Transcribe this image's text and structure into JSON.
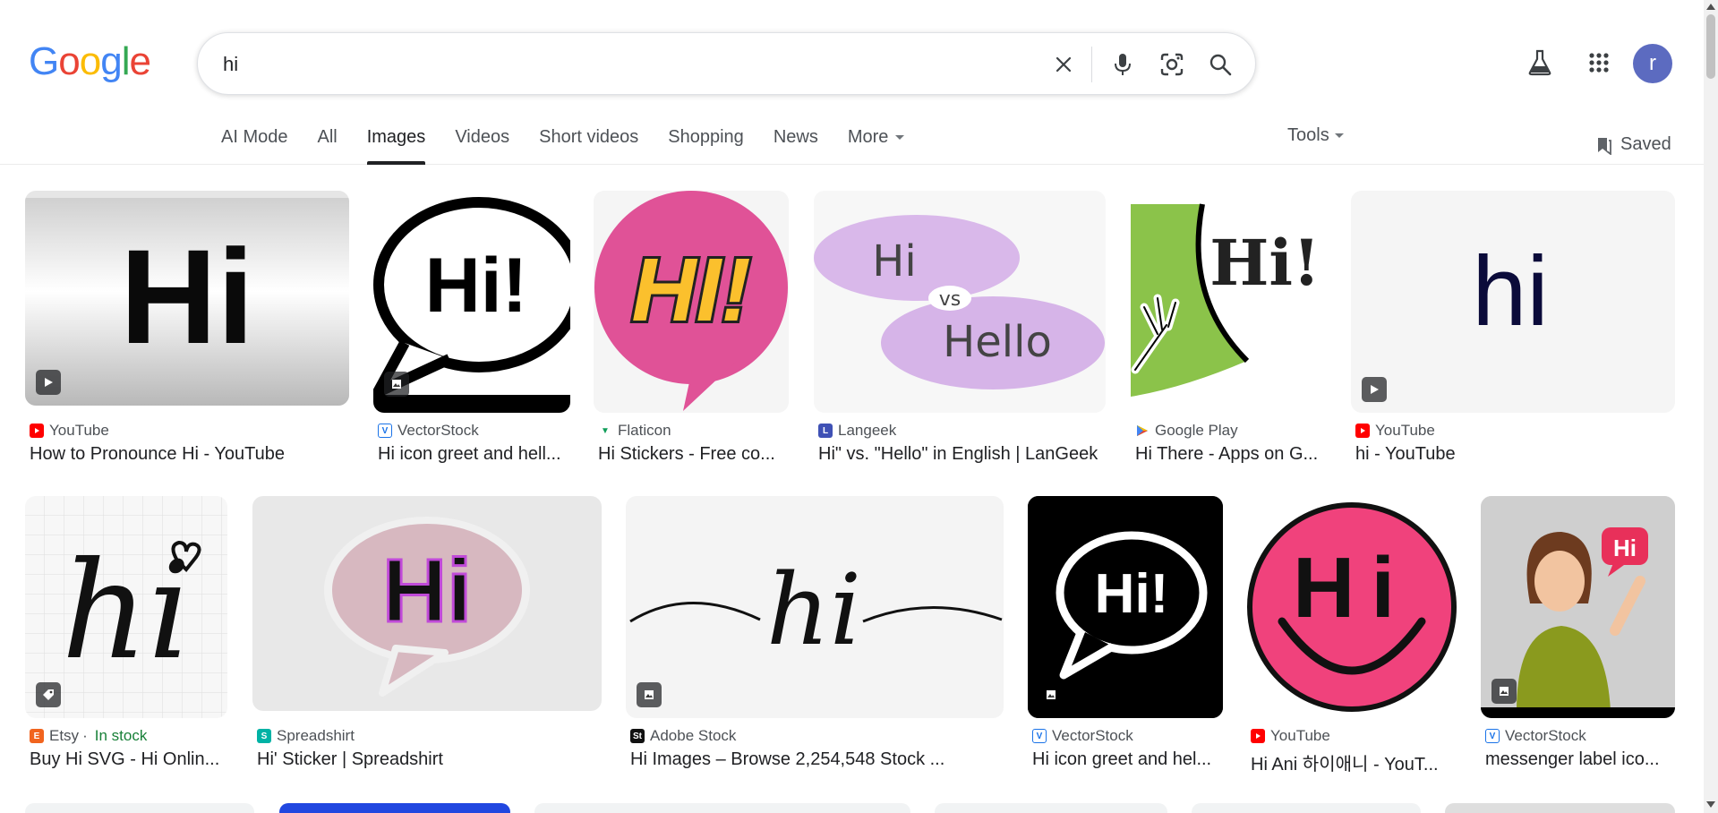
{
  "logo": {
    "letters": [
      "G",
      "o",
      "o",
      "g",
      "l",
      "e"
    ],
    "colors": [
      "#4285F4",
      "#EA4335",
      "#FBBC05",
      "#4285F4",
      "#34A853",
      "#EA4335"
    ]
  },
  "search": {
    "value": "hi",
    "placeholder": ""
  },
  "header": {
    "avatar_letter": "r"
  },
  "tabs": [
    {
      "label": "AI Mode"
    },
    {
      "label": "All"
    },
    {
      "label": "Images",
      "active": true
    },
    {
      "label": "Videos"
    },
    {
      "label": "Short videos"
    },
    {
      "label": "Shopping"
    },
    {
      "label": "News"
    },
    {
      "label": "More"
    }
  ],
  "tools_label": "Tools",
  "saved_label": "Saved",
  "results": [
    {
      "source": "YouTube",
      "title": "How to Pronounce Hi - YouTube",
      "badge": "video",
      "favicon": "youtube"
    },
    {
      "source": "VectorStock",
      "title": "Hi icon greet and hell...",
      "badge": "image",
      "favicon": "vectorstock"
    },
    {
      "source": "Flaticon",
      "title": "Hi Stickers - Free co...",
      "badge": "",
      "favicon": "flaticon"
    },
    {
      "source": "Langeek",
      "title": "Hi\" vs. \"Hello\" in English | LanGeek",
      "badge": "",
      "favicon": "langeek"
    },
    {
      "source": "Google Play",
      "title": "Hi There - Apps on G...",
      "badge": "",
      "favicon": "googleplay"
    },
    {
      "source": "YouTube",
      "title": "hi - YouTube",
      "badge": "video",
      "favicon": "youtube"
    },
    {
      "source": "Etsy",
      "extra": "In stock",
      "title": "Buy Hi SVG - Hi Onlin...",
      "badge": "tag",
      "favicon": "etsy"
    },
    {
      "source": "Spreadshirt",
      "title": "Hi' Sticker | Spreadshirt",
      "badge": "",
      "favicon": "spreadshirt"
    },
    {
      "source": "Adobe Stock",
      "title": "Hi Images – Browse 2,254,548 Stock ...",
      "badge": "image",
      "favicon": "adobestock"
    },
    {
      "source": "VectorStock",
      "title": "Hi icon greet and hel...",
      "badge": "image",
      "favicon": "vectorstock"
    },
    {
      "source": "YouTube",
      "title": "Hi Ani 하이애니 - YouT...",
      "badge": "",
      "favicon": "youtube"
    },
    {
      "source": "VectorStock",
      "title": "messenger label ico...",
      "badge": "image",
      "favicon": "vectorstock"
    }
  ],
  "image_text": {
    "r0": "Hi",
    "r1": "Hi!",
    "r2": "HI!",
    "r3a": "Hi",
    "r3b": "vs",
    "r3c": "Hello",
    "r4": "Hi!",
    "r5": "hi",
    "r6": "hi",
    "r7": "Hi",
    "r8": "hi",
    "r9": "Hi!",
    "r10": "Hi",
    "r11": "Hi"
  },
  "colors": {
    "accent": "#1a73e8",
    "avatar": "#5c6bc0",
    "in_stock": "#188038"
  }
}
